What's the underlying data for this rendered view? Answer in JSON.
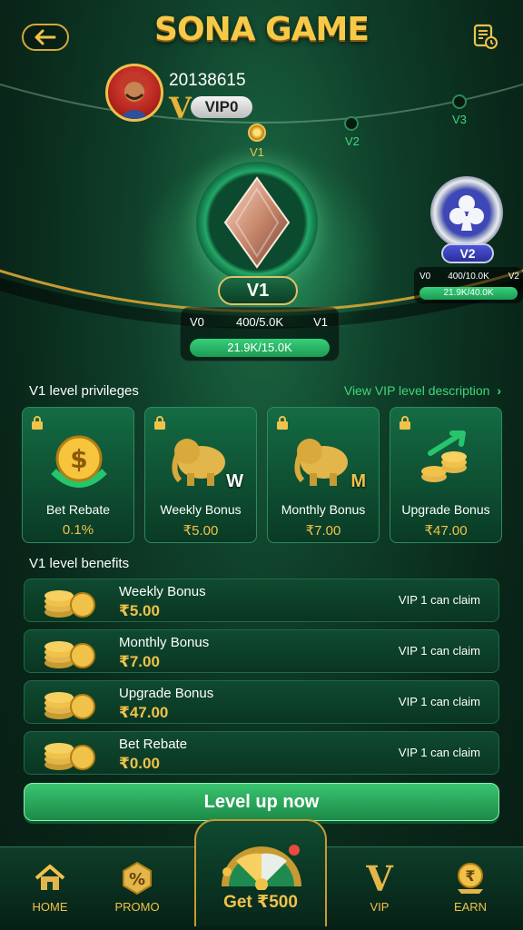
{
  "header": {
    "title": "SONA GAME"
  },
  "profile": {
    "user_id": "20138615",
    "vip_level": "VIP0",
    "vip_badge_letter": "V"
  },
  "track": {
    "levels": [
      "V1",
      "V2",
      "V3"
    ]
  },
  "current_level": {
    "tag": "V1",
    "from": "V0",
    "to": "V1",
    "progress_text": "400/5.0K",
    "bar_text": "21.9K/15.0K"
  },
  "next_level": {
    "tag": "V2",
    "from": "V0",
    "to": "V2",
    "progress_text": "400/10.0K",
    "bar_text": "21.9K/40.0K"
  },
  "privileges": {
    "title": "V1 level privileges",
    "view_link": "View VIP level description",
    "items": [
      {
        "name": "Bet Rebate",
        "value": "0.1%"
      },
      {
        "name": "Weekly Bonus",
        "value": "₹5.00",
        "badge": "W"
      },
      {
        "name": "Monthly Bonus",
        "value": "₹7.00",
        "badge": "M"
      },
      {
        "name": "Upgrade Bonus",
        "value": "₹47.00"
      }
    ]
  },
  "benefits": {
    "title": "V1 level benefits",
    "items": [
      {
        "name": "Weekly Bonus",
        "amount": "₹5.00",
        "claim": "VIP 1 can claim"
      },
      {
        "name": "Monthly Bonus",
        "amount": "₹7.00",
        "claim": "VIP 1 can claim"
      },
      {
        "name": "Upgrade Bonus",
        "amount": "₹47.00",
        "claim": "VIP 1 can claim"
      },
      {
        "name": "Bet Rebate",
        "amount": "₹0.00",
        "claim": "VIP 1 can claim"
      }
    ]
  },
  "level_up_button": "Level up now",
  "bottom_nav": {
    "home": "HOME",
    "promo": "PROMO",
    "center": "Get ₹500",
    "vip": "VIP",
    "earn": "EARN",
    "vip_letter": "V",
    "promo_symbol": "%",
    "earn_symbol": "₹"
  },
  "colors": {
    "accent_gold": "#f0c24a",
    "accent_green": "#3fd77a",
    "background": "#0a2a1c"
  }
}
